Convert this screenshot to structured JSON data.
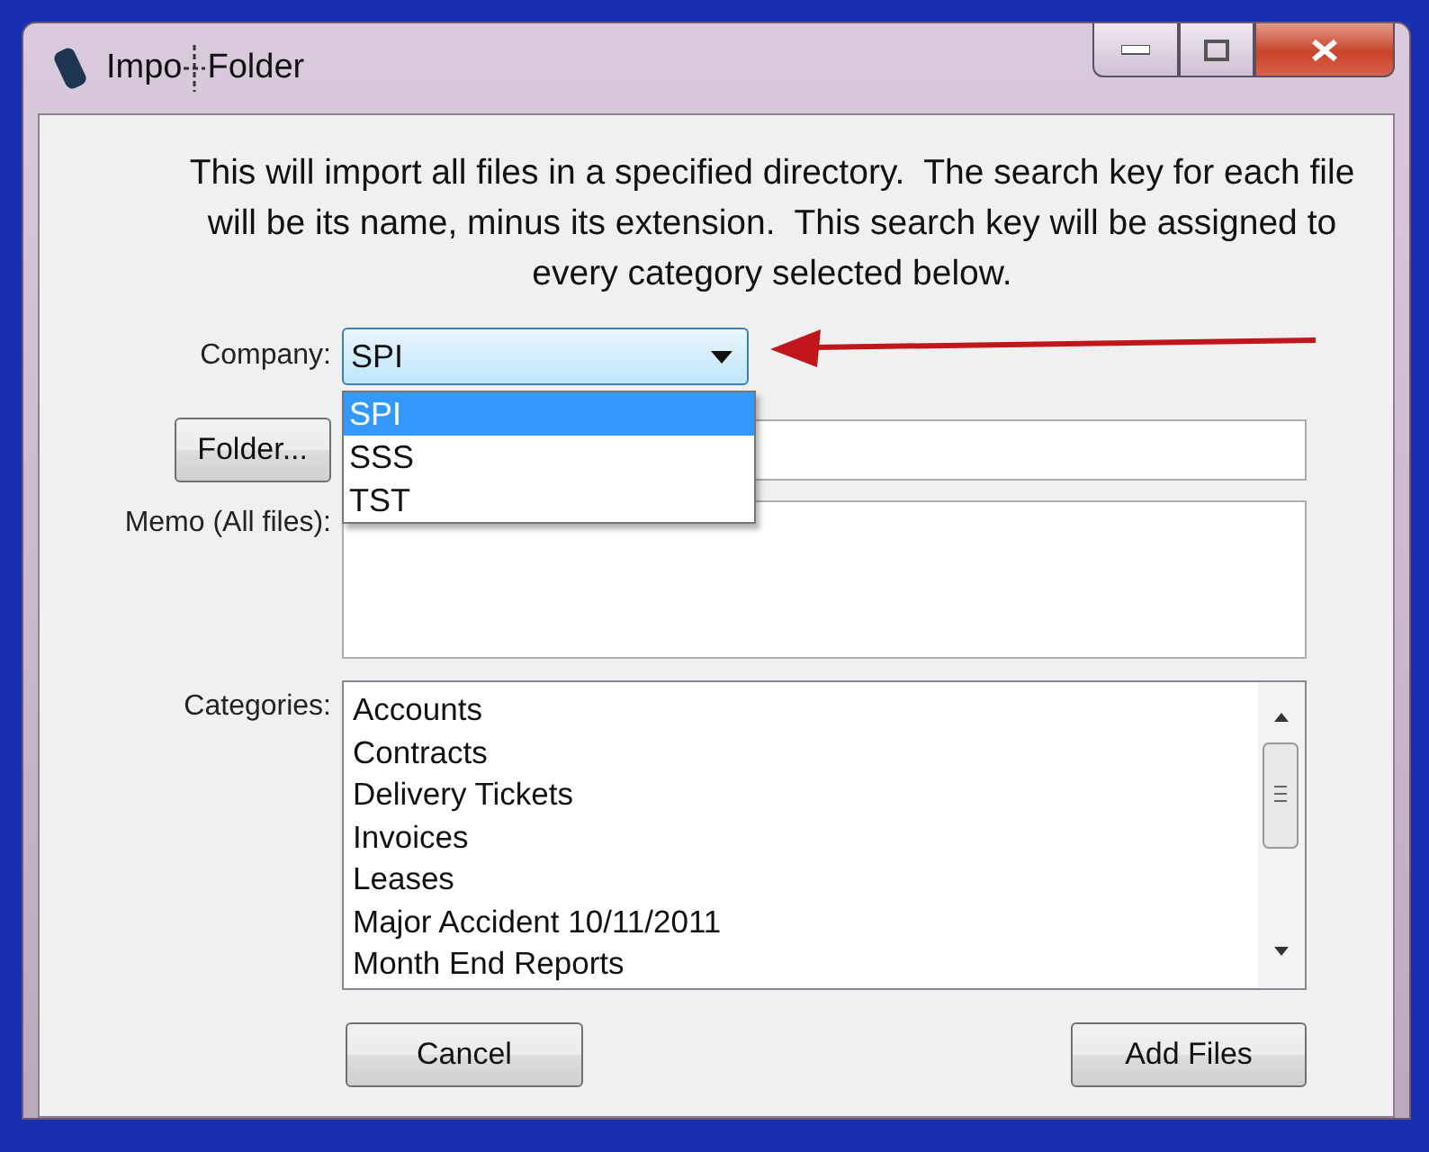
{
  "window": {
    "title_parts": [
      "Impo",
      "Folder"
    ]
  },
  "intro": "This will import all files in a specified directory.  The search key for each file will be its name, minus its extension.  This search key will be assigned to every category selected below.",
  "company": {
    "label": "Company:",
    "value": "SPI",
    "expanded": true,
    "options": [
      {
        "label": "SPI",
        "selected": true
      },
      {
        "label": "SSS",
        "selected": false
      },
      {
        "label": "TST",
        "selected": false
      }
    ]
  },
  "folder": {
    "button": "Folder..."
  },
  "memo": {
    "label": "Memo (All files):"
  },
  "categories": {
    "label": "Categories:",
    "items": [
      {
        "label": "Accounts"
      },
      {
        "label": "Contracts"
      },
      {
        "label": "Delivery Tickets"
      },
      {
        "label": "Invoices"
      },
      {
        "label": "Leases"
      },
      {
        "label": "Major Accident 10/11/2011"
      },
      {
        "label": "Month End Reports"
      }
    ]
  },
  "buttons": {
    "cancel": "Cancel",
    "add": "Add Files"
  }
}
